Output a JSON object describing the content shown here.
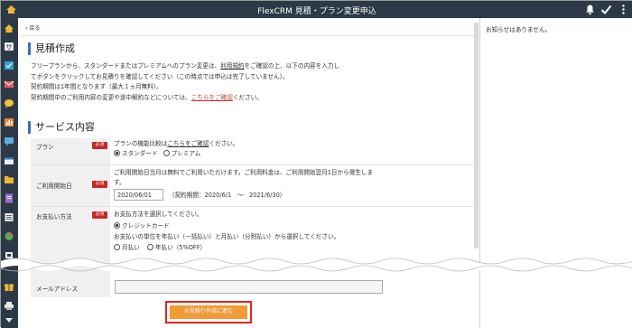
{
  "titlebar": {
    "title": "FlexCRM 見積・プラン変更申込"
  },
  "nav": {
    "back_label": "戻る"
  },
  "estimate": {
    "heading": "見積作成",
    "intro_line1_a": "フリープランから、スタンダードまたはプレミアムへのプラン変更は、",
    "intro_line1_link": "利用規約",
    "intro_line1_b": "をご確認の上、以下の内容を入力し",
    "intro_line2": "てボタンをクリックしてお見積りを確認してください（この時点では申込は完了していません）。",
    "intro_line3": "契約期間は1年間となります（最大１ヵ月無料）。",
    "intro_line4_a": "契約期間中のご利用内容の変更や途中解約などについては、",
    "intro_line4_link": "こちらをご確認",
    "intro_line4_b": "ください。"
  },
  "service": {
    "heading": "サービス内容",
    "required_badge": "必須",
    "plan": {
      "label": "プラン",
      "desc_a": "プランの機能比較は",
      "desc_link": "こちらをご確認",
      "desc_b": "ください。",
      "options": [
        "スタンダード",
        "プレミアム"
      ],
      "selected": "スタンダード"
    },
    "start_date": {
      "label": "ご利用開始日",
      "desc": "ご利用開始日当月は無料でご利用いただけます。ご利用料金は、ご利用開始翌月1日から発生しま",
      "desc2": "す。",
      "value": "2020/06/01",
      "period": "（契約期間：2020/6/1　～　2021/6/30）"
    },
    "payment": {
      "label": "お支払い方法",
      "desc": "お支払方法を選択してください。",
      "method": "クレジットカード",
      "unit_desc": "お支払いの単位を年払い（一括払い）と月払い（分割払い）から選択してください。",
      "partial_option_a": "月払い",
      "partial_option_b": "年払い（5%OFF）"
    },
    "email": {
      "label": "メールアドレス",
      "value": ""
    }
  },
  "submit": {
    "label": "お見積り作成に進む"
  },
  "notice": {
    "text": "お知らせはありません。"
  },
  "colors": {
    "header_bg": "#2c3a47",
    "accent_blue": "#3b6fb6",
    "required_red": "#c62828",
    "button_orange": "#f29a38",
    "highlight_red": "#e0241b"
  }
}
